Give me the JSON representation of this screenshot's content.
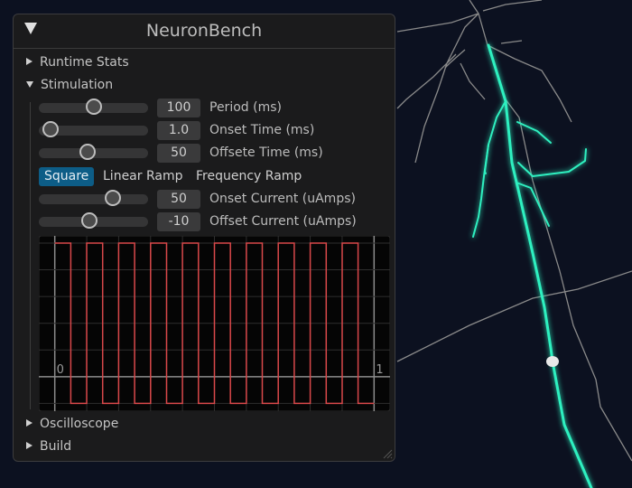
{
  "window": {
    "title": "NeuronBench"
  },
  "sections": {
    "runtime_stats": "Runtime Stats",
    "stimulation": "Stimulation",
    "oscilloscope": "Oscilloscope",
    "build": "Build"
  },
  "sliders": [
    {
      "label": "Period (ms)",
      "value": "100",
      "fraction": 0.5
    },
    {
      "label": "Onset Time (ms)",
      "value": "1.0",
      "fraction": 0.04
    },
    {
      "label": "Offsete Time (ms)",
      "value": "50",
      "fraction": 0.44
    }
  ],
  "waveforms": {
    "options": [
      "Square",
      "Linear Ramp",
      "Frequency Ramp"
    ],
    "selected": "Square"
  },
  "current_sliders": [
    {
      "label": "Onset Current (uAmps)",
      "value": "50",
      "fraction": 0.71
    },
    {
      "label": "Offset Current (uAmps)",
      "value": "-10",
      "fraction": 0.46
    }
  ],
  "colors": {
    "accent": "#0d5d87",
    "signal": "#d9484a",
    "neuron_active": "#2ef0c0",
    "background": "#0c1120"
  },
  "chart_data": {
    "type": "line",
    "x_tick_labels": [
      "0",
      "1"
    ],
    "xlim": [
      -0.05,
      1.05
    ],
    "ylim": [
      -12.9,
      52.7
    ],
    "grid": true,
    "x_grid_step": 0.1,
    "y_grid_step": 10,
    "series": [
      {
        "kind": "square",
        "period": 0.1,
        "high_duration": 0.05,
        "high": 50,
        "low": -10,
        "x_range": [
          0,
          1
        ]
      }
    ]
  }
}
